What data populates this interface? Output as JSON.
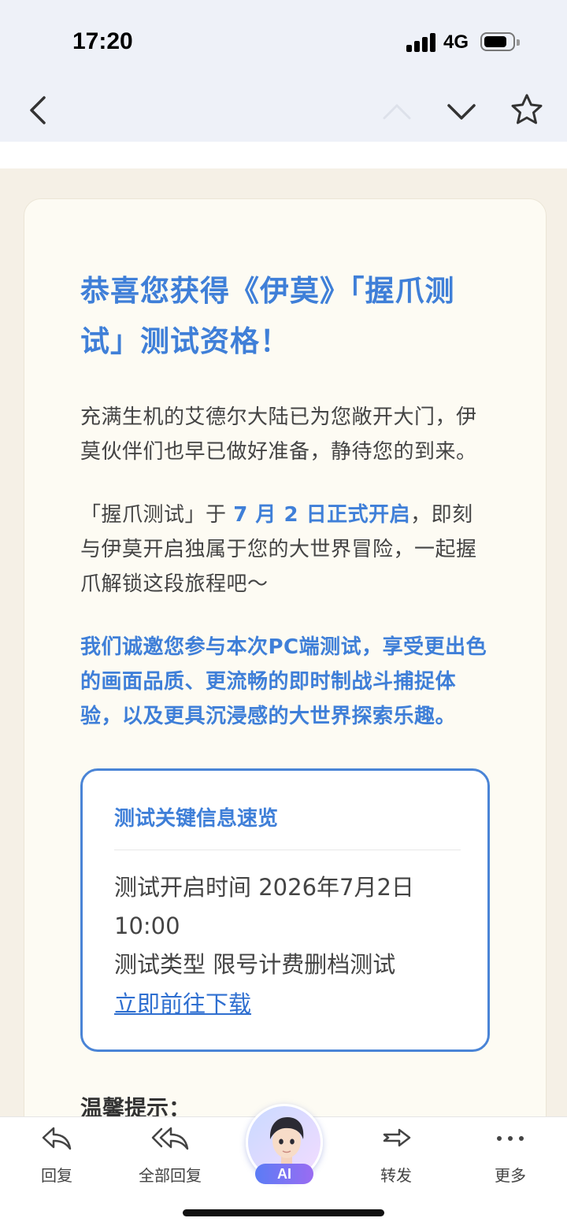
{
  "status_bar": {
    "time": "17:20",
    "network": "4G"
  },
  "email": {
    "headline": "恭喜您获得《伊莫》「握爪测试」测试资格！",
    "paragraph1": "充满生机的艾德尔大陆已为您敞开大门，伊莫伙伴们也早已做好准备，静待您的到来。",
    "paragraph2_prefix": "「握爪测试」于 ",
    "paragraph2_highlight": "7 月 2 日正式开启",
    "paragraph2_suffix": "，即刻与伊莫开启独属于您的大世界冒险，一起握爪解锁这段旅程吧～",
    "paragraph3": "我们诚邀您参与本次PC端测试，享受更出色的画面品质、更流畅的即时制战斗捕捉体验，以及更具沉浸感的大世界探索乐趣。",
    "info_box": {
      "title": "测试关键信息速览",
      "line1": "测试开启时间 2026年7月2日 10:00",
      "line2": "测试类型 限号计费删档测试",
      "link": "立即前往下载"
    },
    "tip_heading": "温馨提示："
  },
  "toolbar": {
    "reply": "回复",
    "reply_all": "全部回复",
    "ai": "AI",
    "forward": "转发",
    "more": "更多"
  },
  "colors": {
    "accent": "#3f7fd8",
    "link": "#2f6fd0",
    "card_bg": "#fdfbf3",
    "page_bg": "#f5f0e6"
  }
}
